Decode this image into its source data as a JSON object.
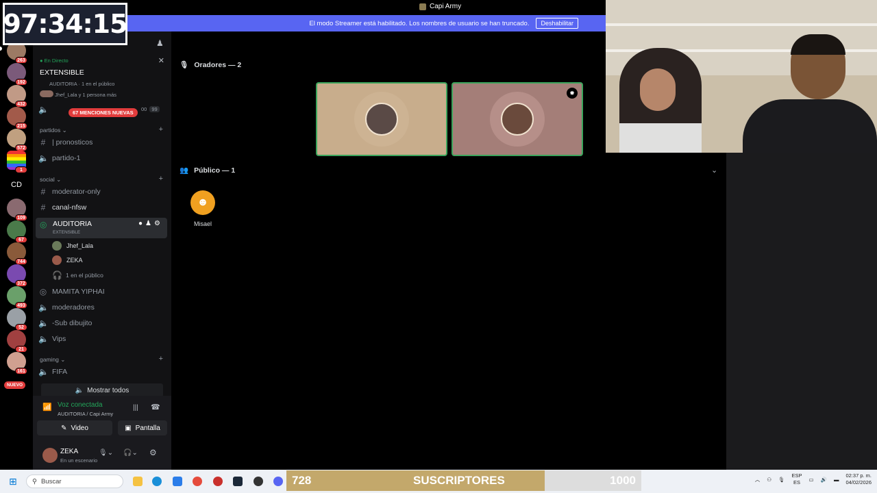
{
  "timer": "97:34:15",
  "window": {
    "title": "Capi Army"
  },
  "banner": {
    "message": "El modo Streamer está habilitado. Los nombres de usuario se han truncado.",
    "button": "Deshabilitar"
  },
  "rail": {
    "badges": [
      "263",
      "192",
      "432",
      "215",
      "572",
      "1",
      "109",
      "67",
      "744",
      "372",
      "493",
      "52",
      "21",
      "161"
    ],
    "cd_label": "CD",
    "nuevo_label": "NUEVO"
  },
  "event": {
    "live_label": "En Directo",
    "title": "EXTENSIBLE",
    "meta": "AUDITORIA · 1 en el público",
    "attendees": "Jhef_Lala y 1 persona más"
  },
  "mentions_badge": "67 MENCIONES NUEVAS",
  "mentions_counts": [
    "00",
    "99"
  ],
  "categories": {
    "partidos": {
      "label": "partidos",
      "channels": [
        "| pronosticos",
        "partido-1"
      ]
    },
    "social": {
      "label": "social",
      "channels": [
        "moderator-only",
        "canal-nfsw"
      ]
    },
    "gaming": {
      "label": "gaming",
      "channels": [
        "FIFA"
      ]
    }
  },
  "stage_channel": {
    "name": "AUDITORIA",
    "subtitle": "EXTENSIBLE",
    "speakers": [
      "Jhef_Lala",
      "ZEKA"
    ],
    "audience": "1 en el público"
  },
  "other_channels": [
    "MAMITA YIPHAI",
    "moderadores",
    "-Sub dibujito",
    "Vips"
  ],
  "show_all": "Mostrar todos",
  "voice": {
    "status": "Voz conectada",
    "location": "AUDITORIA / Capi Army",
    "video_btn": "Video",
    "screen_btn": "Pantalla"
  },
  "user": {
    "name": "ZEKA",
    "status": "En un escenario"
  },
  "main": {
    "speakers_header": "Oradores — 2",
    "audience_header": "Público — 1",
    "audience_members": [
      "Misael"
    ]
  },
  "subs": {
    "current": "728",
    "label": "SUSCRIPTORES",
    "goal": "1000",
    "progress": 0.728
  },
  "taskbar": {
    "search_placeholder": "Buscar",
    "lang": "ESP",
    "lang2": "ES",
    "time": "02:37 p. m.",
    "date": "04/02/2026"
  },
  "colors": {
    "accent": "#5865f2",
    "online": "#23a55a",
    "danger": "#e23c3c",
    "sub_fill": "#c3a86b"
  }
}
